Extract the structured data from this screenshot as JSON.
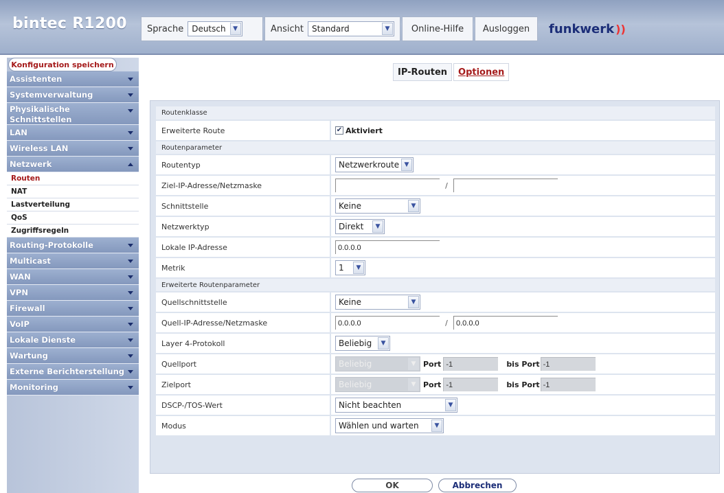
{
  "app": {
    "brand": "bintec R1200"
  },
  "topbar": {
    "language_label": "Sprache",
    "language_value": "Deutsch",
    "view_label": "Ansicht",
    "view_value": "Standard",
    "help": "Online-Hilfe",
    "logout": "Ausloggen",
    "logo": "funkwerk"
  },
  "sidebar": {
    "save": "Konfiguration speichern",
    "items": [
      {
        "label": "Assistenten"
      },
      {
        "label": "Systemverwaltung"
      },
      {
        "label": "Physikalische Schnittstellen"
      },
      {
        "label": "LAN"
      },
      {
        "label": "Wireless LAN"
      },
      {
        "label": "Netzwerk"
      },
      {
        "label": "Routing-Protokolle"
      },
      {
        "label": "Multicast"
      },
      {
        "label": "WAN"
      },
      {
        "label": "VPN"
      },
      {
        "label": "Firewall"
      },
      {
        "label": "VoIP"
      },
      {
        "label": "Lokale Dienste"
      },
      {
        "label": "Wartung"
      },
      {
        "label": "Externe Berichterstellung"
      },
      {
        "label": "Monitoring"
      }
    ],
    "netzwerk_sub": [
      "Routen",
      "NAT",
      "Lastverteilung",
      "QoS",
      "Zugriffsregeln"
    ]
  },
  "tabs": {
    "active": "IP-Routen",
    "options": "Optionen"
  },
  "form": {
    "sec_class": "Routenklasse",
    "ext_route_label": "Erweiterte Route",
    "ext_route_value": "Aktiviert",
    "sec_params": "Routenparameter",
    "route_type_label": "Routentyp",
    "route_type_value": "Netzwerkroute",
    "dest_label": "Ziel-IP-Adresse/Netzmaske",
    "dest_ip": "",
    "dest_mask": "",
    "iface_label": "Schnittstelle",
    "iface_value": "Keine",
    "nettype_label": "Netzwerktyp",
    "nettype_value": "Direkt",
    "local_ip_label": "Lokale IP-Adresse",
    "local_ip_value": "0.0.0.0",
    "metric_label": "Metrik",
    "metric_value": "1",
    "sec_ext": "Erweiterte Routenparameter",
    "src_iface_label": "Quellschnittstelle",
    "src_iface_value": "Keine",
    "src_ip_label": "Quell-IP-Adresse/Netzmaske",
    "src_ip": "0.0.0.0",
    "src_mask": "0.0.0.0",
    "l4_label": "Layer 4-Protokoll",
    "l4_value": "Beliebig",
    "srcport_label": "Quellport",
    "srcport_sel": "Beliebig",
    "port_label": "Port",
    "srcport_port": "-1",
    "bisport_label": "bis Port",
    "srcport_bis": "-1",
    "dstport_label": "Zielport",
    "dstport_sel": "Beliebig",
    "dstport_port": "-1",
    "dstport_bis": "-1",
    "dscp_label": "DSCP-/TOS-Wert",
    "dscp_value": "Nicht beachten",
    "mode_label": "Modus",
    "mode_value": "Wählen und warten"
  },
  "buttons": {
    "ok": "OK",
    "cancel": "Abbrechen"
  }
}
